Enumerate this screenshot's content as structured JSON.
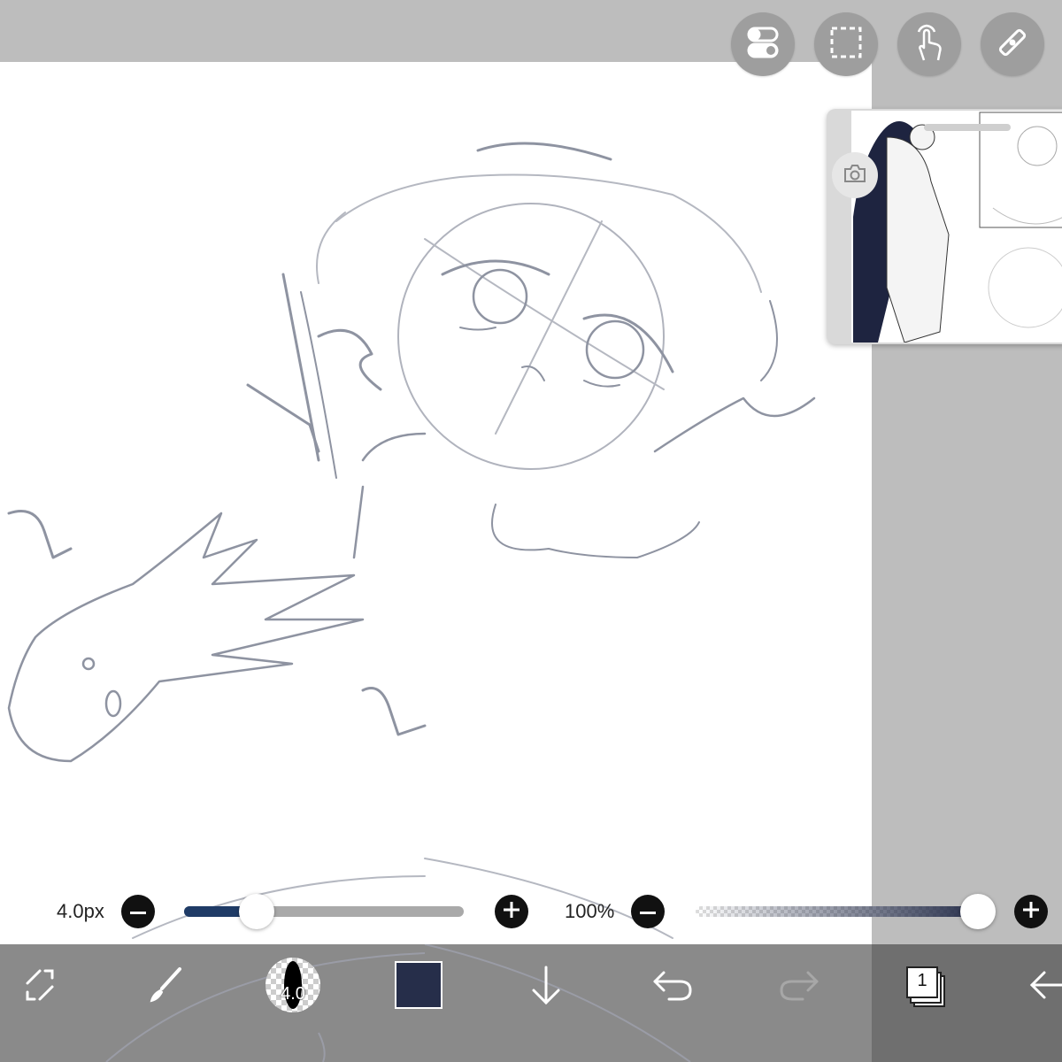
{
  "toolbar_top": {
    "buttons": [
      {
        "name": "toggle-icon"
      },
      {
        "name": "selection-icon"
      },
      {
        "name": "touch-icon"
      },
      {
        "name": "ruler-icon"
      }
    ]
  },
  "reference_window": {
    "camera_icon": "camera-icon"
  },
  "brush_slider": {
    "label": "4.0px",
    "value_fraction": 0.26,
    "accent": "#1f3b66"
  },
  "opacity_slider": {
    "label": "100%",
    "value_fraction": 1.0,
    "accent": "#262e4a"
  },
  "bottom_toolbar": {
    "brush_size_value": "4.0",
    "color": "#262e4a",
    "layer_count": "1"
  },
  "colors": {
    "canvas": "#ffffff",
    "panel": "#bdbdbd",
    "bottom_bar": "#8a8a8a",
    "sketch_line": "#8a8f9e"
  }
}
